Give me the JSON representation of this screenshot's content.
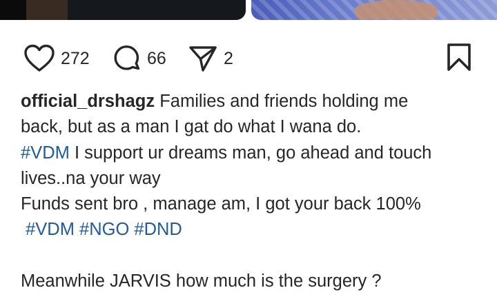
{
  "post": {
    "media": [
      "photo-left",
      "photo-right"
    ],
    "actions": {
      "likes_count": "272",
      "comments_count": "66",
      "shares_count": "2",
      "icons": [
        "heart-icon",
        "comment-icon",
        "share-icon",
        "bookmark-icon"
      ]
    },
    "caption": {
      "username": "official_drshagz",
      "line1_text": "Families and friends holding me",
      "line2_text": "back, but as a man I gat do what I wana do.",
      "line3_tag": "#VDM",
      "line3_text": "I support ur dreams man, go ahead and touch",
      "line4_text": "lives..na your way",
      "line5_text": "Funds sent bro , manage am, I got your back 100%",
      "tags": [
        "#VDM",
        "#NGO",
        "#DND"
      ],
      "line8_text": "Meanwhile JARVIS how much is the surgery ?"
    }
  },
  "colors": {
    "text": "#262626",
    "hashtag": "#1f5aa8",
    "background": "#ffffff"
  }
}
